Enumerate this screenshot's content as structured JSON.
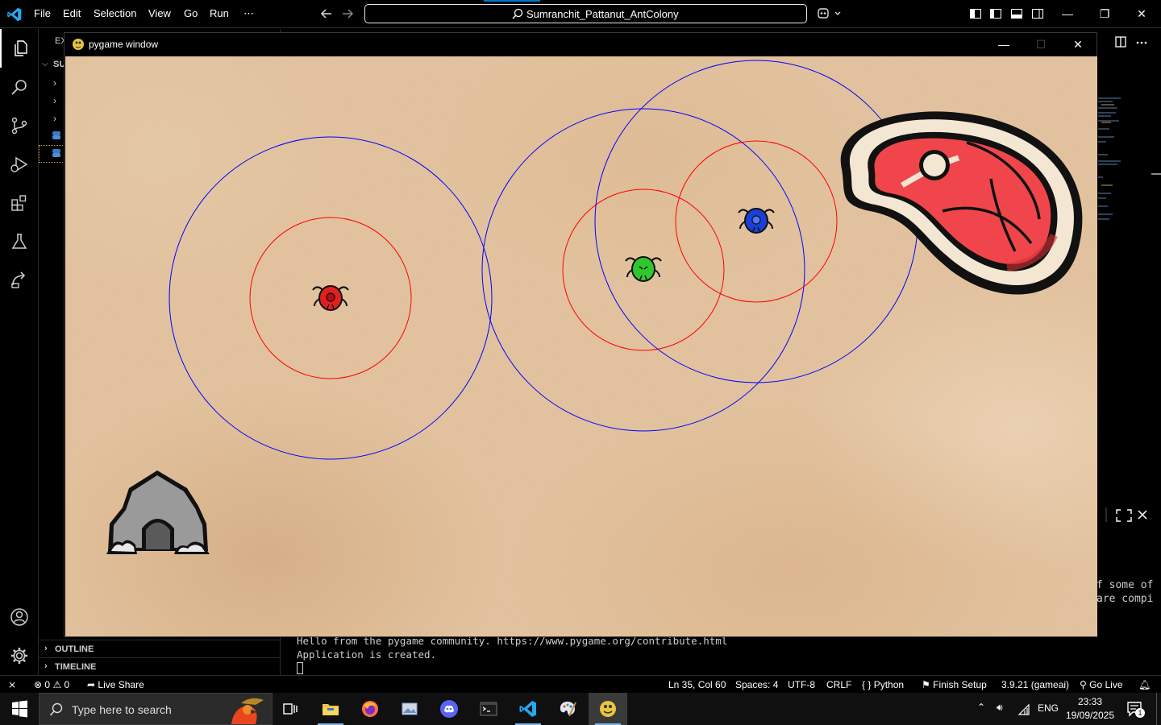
{
  "titlebar": {
    "menus": [
      "File",
      "Edit",
      "Selection",
      "View",
      "Go",
      "Run",
      "⋯"
    ],
    "command_center": "Sumranchit_Pattanut_AntColony",
    "window_controls": [
      "—",
      "❐",
      "✕"
    ]
  },
  "activitybar": {
    "items": [
      "files-icon",
      "search-icon",
      "source-control-icon",
      "run-debug-icon",
      "extensions-icon",
      "testing-icon",
      "remote-icon"
    ],
    "bottom": [
      "account-icon",
      "settings-gear-icon"
    ]
  },
  "sidebar": {
    "tab_fragment": "EX",
    "section_fragment": "SU",
    "outline_label": "OUTLINE",
    "timeline_label": "TIMELINE"
  },
  "right_code_fragment": [
    "f some of",
    " are compi"
  ],
  "terminal": {
    "lines": [
      "Hello from the pygame community. https://www.pygame.org/contribute.html",
      "Application is created."
    ]
  },
  "pygame": {
    "title": "pygame window",
    "controls": [
      "—",
      "☐",
      "✕"
    ],
    "colors": {
      "sand": "#e6c6a2",
      "view_circle": "#0000ff",
      "attack_circle": "#ff0000",
      "ant_red": "#e02020",
      "ant_green": "#2ec82e",
      "ant_blue": "#1b3fd6",
      "meat": "#f0464b",
      "meat_fat": "#f3e6d3"
    },
    "sprites": [
      "ant-red",
      "ant-green",
      "ant-blue",
      "meat-food",
      "nest-cave"
    ]
  },
  "statusbar": {
    "remote": "⨯",
    "errors": "0",
    "warnings": "0",
    "live_share": "Live Share",
    "cursor": "Ln 35, Col 60",
    "spaces": "Spaces: 4",
    "encoding": "UTF-8",
    "eol": "CRLF",
    "language": "Python",
    "finish_setup": "Finish Setup",
    "interpreter": "3.9.21 (gameai)",
    "go_live": "Go Live"
  },
  "taskbar": {
    "search_placeholder": "Type here to search",
    "apps": [
      "task-view",
      "file-explorer",
      "firefox",
      "photos",
      "discord",
      "terminal",
      "vscode",
      "paint",
      "pygame"
    ],
    "language": "ENG",
    "time": "23:33",
    "date": "19/09/2025",
    "notifications": "1"
  }
}
